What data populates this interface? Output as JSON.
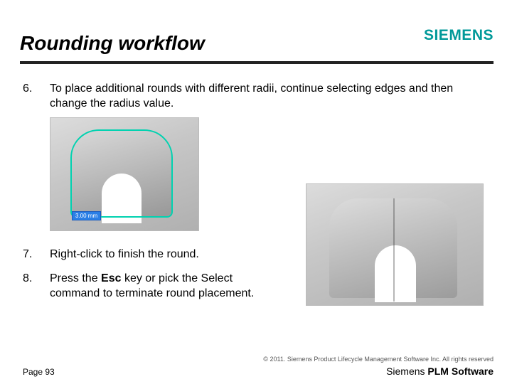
{
  "header": {
    "title": "Rounding workflow",
    "logo": "SIEMENS"
  },
  "steps": {
    "s6": {
      "num": "6.",
      "text": "To place additional rounds with different radii, continue selecting edges and then change the radius value."
    },
    "s7": {
      "num": "7.",
      "text": "Right-click to finish the round."
    },
    "s8": {
      "num": "8.",
      "pre": "Press the ",
      "bold": "Esc",
      "post": " key or pick the Select command to terminate round placement."
    }
  },
  "cad": {
    "dim_label": "3.00 mm"
  },
  "footer": {
    "copyright": "© 2011. Siemens Product Lifecycle Management Software Inc. All rights reserved",
    "page": "Page 93",
    "brand_prefix": "Siemens ",
    "brand_bold": "PLM Software"
  }
}
